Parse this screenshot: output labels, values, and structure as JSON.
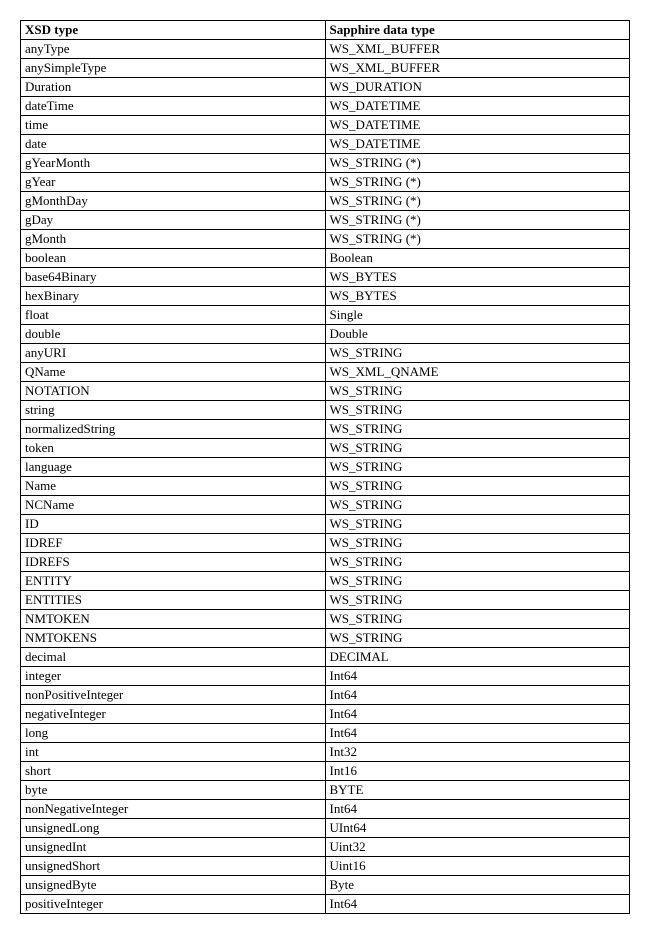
{
  "table": {
    "headers": {
      "xsd": "XSD type",
      "sapphire": "Sapphire data type"
    },
    "rows": [
      {
        "xsd": "anyType",
        "sapphire": "WS_XML_BUFFER"
      },
      {
        "xsd": "anySimpleType",
        "sapphire": "WS_XML_BUFFER"
      },
      {
        "xsd": "Duration",
        "sapphire": "WS_DURATION"
      },
      {
        "xsd": "dateTime",
        "sapphire": "WS_DATETIME"
      },
      {
        "xsd": "time",
        "sapphire": "WS_DATETIME"
      },
      {
        "xsd": "date",
        "sapphire": "WS_DATETIME"
      },
      {
        "xsd": "gYearMonth",
        "sapphire": "WS_STRING (*)"
      },
      {
        "xsd": "gYear",
        "sapphire": "WS_STRING (*)"
      },
      {
        "xsd": "gMonthDay",
        "sapphire": "WS_STRING (*)"
      },
      {
        "xsd": "gDay",
        "sapphire": "WS_STRING (*)"
      },
      {
        "xsd": "gMonth",
        "sapphire": "WS_STRING (*)"
      },
      {
        "xsd": "boolean",
        "sapphire": "Boolean"
      },
      {
        "xsd": "base64Binary",
        "sapphire": "WS_BYTES"
      },
      {
        "xsd": "hexBinary",
        "sapphire": " WS_BYTES"
      },
      {
        "xsd": "float",
        "sapphire": "Single"
      },
      {
        "xsd": "double",
        "sapphire": "Double"
      },
      {
        "xsd": "anyURI",
        "sapphire": "WS_STRING"
      },
      {
        "xsd": "QName",
        "sapphire": "WS_XML_QNAME"
      },
      {
        "xsd": "NOTATION",
        "sapphire": "WS_STRING"
      },
      {
        "xsd": "string",
        "sapphire": "WS_STRING"
      },
      {
        "xsd": "normalizedString",
        "sapphire": "WS_STRING"
      },
      {
        "xsd": "token",
        "sapphire": "WS_STRING"
      },
      {
        "xsd": "language",
        "sapphire": "WS_STRING"
      },
      {
        "xsd": "Name",
        "sapphire": "WS_STRING"
      },
      {
        "xsd": "NCName",
        "sapphire": "WS_STRING"
      },
      {
        "xsd": "ID",
        "sapphire": "WS_STRING"
      },
      {
        "xsd": "IDREF",
        "sapphire": "WS_STRING"
      },
      {
        "xsd": "IDREFS",
        "sapphire": "WS_STRING"
      },
      {
        "xsd": "ENTITY",
        "sapphire": "WS_STRING"
      },
      {
        "xsd": "ENTITIES",
        "sapphire": "WS_STRING"
      },
      {
        "xsd": "NMTOKEN",
        "sapphire": "WS_STRING"
      },
      {
        "xsd": "NMTOKENS",
        "sapphire": "WS_STRING"
      },
      {
        "xsd": "decimal",
        "sapphire": "DECIMAL"
      },
      {
        "xsd": "integer",
        "sapphire": "Int64"
      },
      {
        "xsd": "nonPositiveInteger",
        "sapphire": "Int64"
      },
      {
        "xsd": "negativeInteger",
        "sapphire": "Int64"
      },
      {
        "xsd": "long",
        "sapphire": "Int64"
      },
      {
        "xsd": "int",
        "sapphire": "Int32"
      },
      {
        "xsd": "short",
        "sapphire": "Int16"
      },
      {
        "xsd": "byte",
        "sapphire": "BYTE"
      },
      {
        "xsd": "nonNegativeInteger",
        "sapphire": "Int64"
      },
      {
        "xsd": "unsignedLong",
        "sapphire": "UInt64"
      },
      {
        "xsd": "unsignedInt",
        "sapphire": "Uint32"
      },
      {
        "xsd": "unsignedShort",
        "sapphire": "Uint16"
      },
      {
        "xsd": "unsignedByte",
        "sapphire": "Byte"
      },
      {
        "xsd": "positiveInteger",
        "sapphire": "Int64"
      }
    ]
  }
}
